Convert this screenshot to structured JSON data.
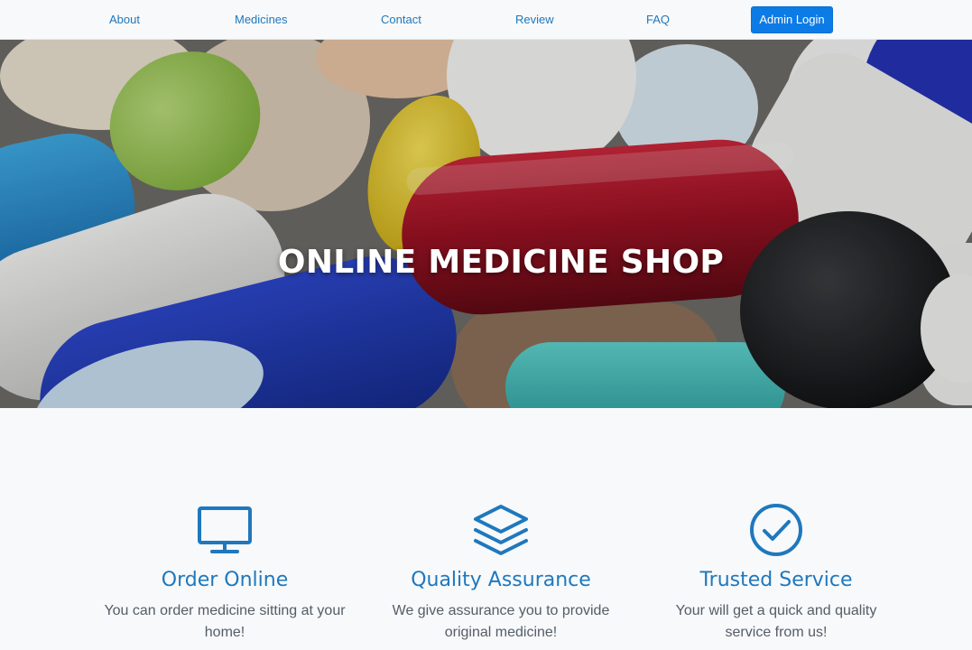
{
  "nav": {
    "links": [
      "About",
      "Medicines",
      "Contact",
      "Review",
      "FAQ"
    ],
    "admin_button": "Admin Login"
  },
  "hero": {
    "title": "ONLINE MEDICINE SHOP"
  },
  "features": [
    {
      "icon": "monitor-icon",
      "title": "Order Online",
      "text": "You can order medicine sitting at your home!"
    },
    {
      "icon": "layers-icon",
      "title": "Quality Assurance",
      "text": "We give assurance you to provide original medicine!"
    },
    {
      "icon": "check-circle-icon",
      "title": "Trusted Service",
      "text": "Your will get a quick and quality service from us!"
    }
  ],
  "colors": {
    "accent": "#1f78bd",
    "button": "#0d7be6",
    "page_background": "#f7f9fb"
  }
}
